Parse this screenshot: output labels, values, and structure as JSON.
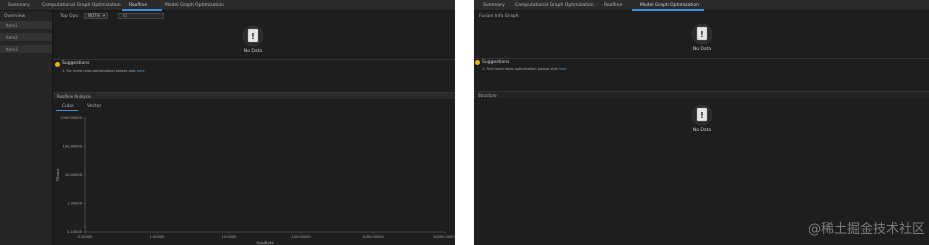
{
  "left": {
    "tabs": [
      {
        "label": "Summary",
        "active": false
      },
      {
        "label": "Computational Graph Optimization",
        "active": false
      },
      {
        "label": "Roofline",
        "active": true
      },
      {
        "label": "Model Graph Optimization",
        "active": false
      }
    ],
    "sidebar": {
      "title": "Overview",
      "items": [
        {
          "label": "Item1"
        },
        {
          "label": "Item2"
        },
        {
          "label": "Item3"
        }
      ]
    },
    "toolbar": {
      "topn_label": "Top Ops:",
      "topn_value": "NOTH",
      "search_placeholder": "ID"
    },
    "nodata_text": "No Data",
    "suggestions": {
      "title": "Suggestions",
      "item_prefix": "1. For more roles-optimization please visit",
      "item_link": "here"
    },
    "roofline": {
      "section_title": "Roofline Analysis",
      "subtabs": [
        {
          "label": "Cube",
          "active": true
        },
        {
          "label": "Vector",
          "active": false
        }
      ],
      "chart_data": {
        "type": "scatter",
        "xlabel": "Ops/Byte",
        "ylabel": "Tflop/s",
        "xticks": [
          "0.10000",
          "1.00000",
          "10.0000",
          "100.00000",
          "1000.00000",
          "10000.00000"
        ],
        "yticks": [
          "1000.00000",
          "100.00000",
          "10.00000",
          "1.00000",
          "0.10000"
        ],
        "xscale": "log",
        "yscale": "log",
        "xlim": [
          0.1,
          10000
        ],
        "ylim": [
          0.1,
          1000
        ],
        "series": [],
        "grid": false
      }
    }
  },
  "right": {
    "tabs": [
      {
        "label": "Summary",
        "active": false
      },
      {
        "label": "Computational Graph Optimization",
        "active": false
      },
      {
        "label": "Roofline",
        "active": false
      },
      {
        "label": "Model Graph Optimization",
        "active": true
      }
    ],
    "section1_title": "Fusion Info Graph",
    "nodata_text": "No Data",
    "suggestions": {
      "title": "Suggestions",
      "item_prefix": "1. Find more roles-optimization please visit",
      "item_link": "here"
    },
    "section2_title": "Structure"
  },
  "watermark": "@稀土掘金技术社区",
  "colors": {
    "accent": "#3a8de0",
    "background": "#1e1e1e",
    "warning": "#e8b400",
    "link": "#5b9bd5"
  }
}
